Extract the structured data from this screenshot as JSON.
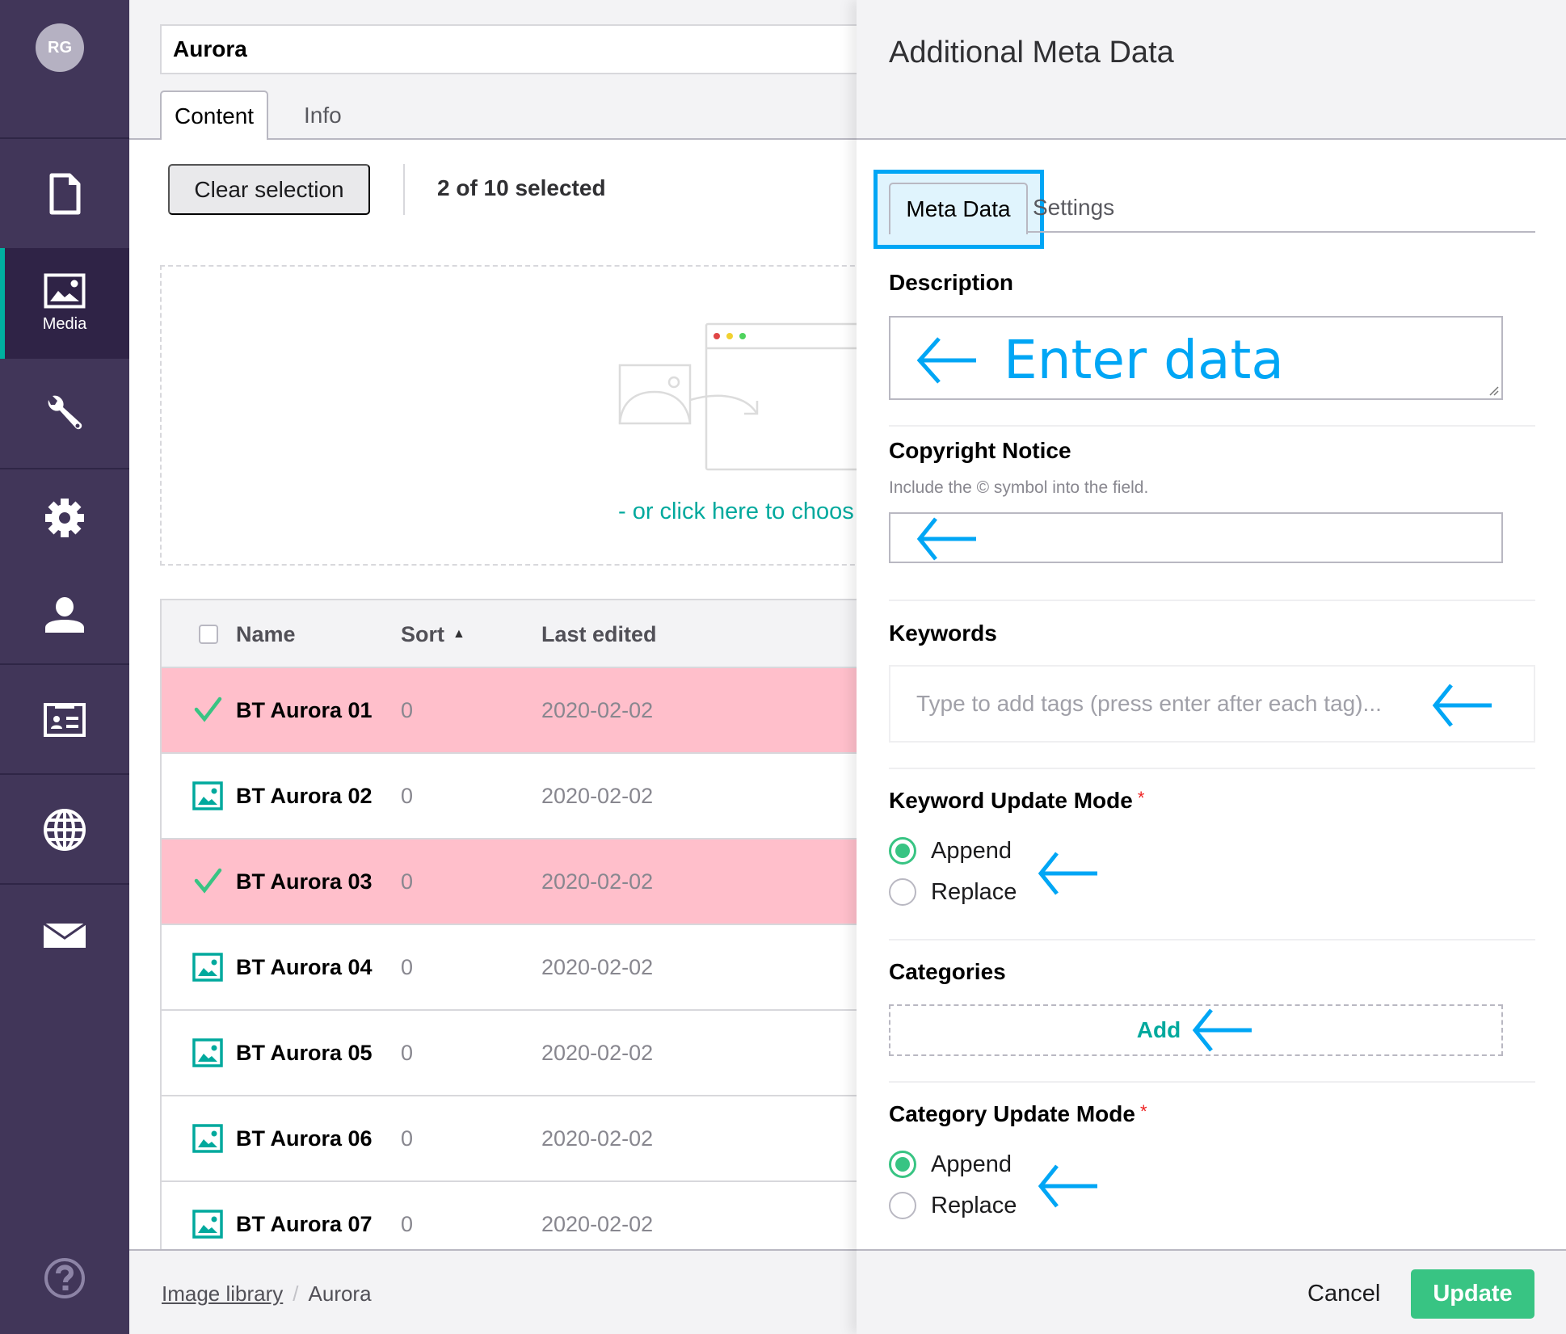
{
  "sidebar": {
    "avatar_initials": "RG",
    "items": [
      {
        "name": "content",
        "icon": "document-icon",
        "label": ""
      },
      {
        "name": "media",
        "icon": "image-icon",
        "label": "Media",
        "active": true
      },
      {
        "name": "settings-tools",
        "icon": "wrench-icon",
        "label": ""
      },
      {
        "name": "settings",
        "icon": "gear-icon",
        "label": ""
      },
      {
        "name": "users",
        "icon": "user-icon",
        "label": ""
      },
      {
        "name": "members",
        "icon": "id-card-icon",
        "label": ""
      },
      {
        "name": "translation",
        "icon": "globe-icon",
        "label": ""
      },
      {
        "name": "forms",
        "icon": "mail-icon",
        "label": ""
      },
      {
        "name": "help",
        "icon": "help-icon",
        "label": ""
      }
    ],
    "accent_color": "#00b0a0"
  },
  "main": {
    "name_value": "Aurora",
    "tabs": [
      {
        "label": "Content",
        "active": true
      },
      {
        "label": "Info",
        "active": false
      }
    ],
    "toolbar": {
      "clear_selection_label": "Clear selection",
      "selection_count": "2 of 10 selected"
    },
    "dropzone": {
      "link_text": "- or click here to choos"
    },
    "table": {
      "columns": [
        "Name",
        "Sort",
        "Last edited"
      ],
      "sort_indicator": "▲",
      "rows": [
        {
          "name": "BT Aurora 01",
          "sort": "0",
          "last_edited": "2020-02-02",
          "selected": true
        },
        {
          "name": "BT Aurora 02",
          "sort": "0",
          "last_edited": "2020-02-02",
          "selected": false
        },
        {
          "name": "BT Aurora 03",
          "sort": "0",
          "last_edited": "2020-02-02",
          "selected": true
        },
        {
          "name": "BT Aurora 04",
          "sort": "0",
          "last_edited": "2020-02-02",
          "selected": false
        },
        {
          "name": "BT Aurora 05",
          "sort": "0",
          "last_edited": "2020-02-02",
          "selected": false
        },
        {
          "name": "BT Aurora 06",
          "sort": "0",
          "last_edited": "2020-02-02",
          "selected": false
        },
        {
          "name": "BT Aurora 07",
          "sort": "0",
          "last_edited": "2020-02-02",
          "selected": false
        }
      ],
      "selected_row_color": "#ffbfcb"
    },
    "breadcrumb": {
      "items": [
        "Image library",
        "Aurora"
      ],
      "separator": "/"
    }
  },
  "panel": {
    "title": "Additional Meta Data",
    "tabs": [
      {
        "label": "Meta Data",
        "active": true
      },
      {
        "label": "Settings",
        "active": false
      }
    ],
    "fields": {
      "description": {
        "label": "Description",
        "annotation": "Enter data"
      },
      "copyright": {
        "label": "Copyright Notice",
        "hint": "Include the © symbol into the field.",
        "value": ""
      },
      "keywords": {
        "label": "Keywords",
        "placeholder": "Type to add tags (press enter after each tag)..."
      },
      "keyword_update_mode": {
        "label": "Keyword Update Mode",
        "required_mark": "*",
        "options": [
          "Append",
          "Replace"
        ],
        "selected": "Append"
      },
      "categories": {
        "label": "Categories",
        "add_label": "Add"
      },
      "category_update_mode": {
        "label": "Category Update Mode",
        "required_mark": "*",
        "options": [
          "Append",
          "Replace"
        ],
        "selected": "Append"
      }
    },
    "footer": {
      "cancel_label": "Cancel",
      "update_label": "Update"
    },
    "annotation_color": "#00a6f5",
    "success_color": "#38c483"
  }
}
